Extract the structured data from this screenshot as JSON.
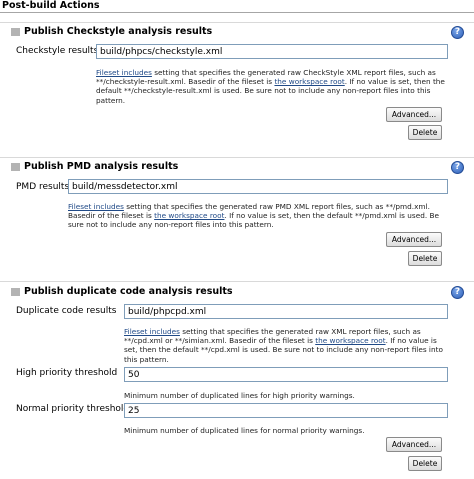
{
  "page": {
    "title": "Post-build Actions"
  },
  "checkstyle": {
    "title": "Publish Checkstyle analysis results",
    "results_label": "Checkstyle results",
    "results_value": "build/phpcs/checkstyle.xml",
    "help": {
      "link1": "Fileset includes",
      "text1": " setting that specifies the generated raw CheckStyle XML report files, such as **/checkstyle-result.xml. Basedir of the fileset is ",
      "link2": "the workspace root",
      "text2": ". If no value is set, then the default **/checkstyle-result.xml is used. Be sure not to include any non-report files into this pattern."
    },
    "advanced_label": "Advanced...",
    "delete_label": "Delete"
  },
  "pmd": {
    "title": "Publish PMD analysis results",
    "results_label": "PMD results",
    "results_value": "build/messdetector.xml",
    "help": {
      "link1": "Fileset includes",
      "text1": " setting that specifies the generated raw PMD XML report files, such as **/pmd.xml. Basedir of the fileset is ",
      "link2": "the workspace root",
      "text2": ". If no value is set, then the default **/pmd.xml is used. Be sure not to include any non-report files into this pattern."
    },
    "advanced_label": "Advanced...",
    "delete_label": "Delete"
  },
  "duplicate": {
    "title": "Publish duplicate code analysis results",
    "results_label": "Duplicate code results",
    "results_value": "build/phpcpd.xml",
    "help": {
      "link1": "Fileset includes",
      "text1": " setting that specifies the generated raw XML report files, such as **/cpd.xml or **/simian.xml. Basedir of the fileset is ",
      "link2": "the workspace root",
      "text2": ". If no value is set, then the default **/cpd.xml is used. Be sure not to include any non-report files into this pattern."
    },
    "high_label": "High priority threshold",
    "high_value": "50",
    "high_help": "Minimum number of duplicated lines for high priority warnings.",
    "normal_label": "Normal priority threshold",
    "normal_value": "25",
    "normal_help": "Minimum number of duplicated lines for normal priority warnings.",
    "advanced_label": "Advanced...",
    "delete_label": "Delete"
  },
  "help_icon_glyph": "?",
  "icons": {
    "help": "help-icon",
    "grip": "drag-handle-icon"
  }
}
